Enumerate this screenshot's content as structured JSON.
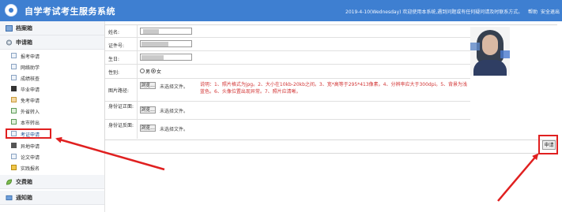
{
  "header": {
    "app_title": "自学考试考生服务系统",
    "welcome": "2019-4-10(Wednesday) 欢迎使用本系统,遇到问题或有任何疑问请及时联系方式。",
    "help": "帮助",
    "logout": "安全退出"
  },
  "sidebar": {
    "sections": [
      {
        "label": "档案箱",
        "icon": "archive-icon"
      },
      {
        "label": "申请箱",
        "icon": "gear-icon"
      },
      {
        "label": "交费箱",
        "icon": "leaf-icon"
      },
      {
        "label": "通知箱",
        "icon": "bell-icon"
      }
    ],
    "items": [
      {
        "label": "报考申请"
      },
      {
        "label": "网络助学"
      },
      {
        "label": "成绩核查"
      },
      {
        "label": "毕业申请"
      },
      {
        "label": "免考申请"
      },
      {
        "label": "外省转入"
      },
      {
        "label": "本市转出"
      },
      {
        "label": "考证申请"
      },
      {
        "label": "异地申请"
      },
      {
        "label": "论文申请"
      },
      {
        "label": "实践报名"
      }
    ],
    "active_item": "考证申请"
  },
  "form": {
    "name_label": "姓名:",
    "id_label": "证件号:",
    "birth_label": "生日:",
    "gender_label": "性别:",
    "gender_male": "男",
    "gender_female": "女",
    "gender_selected": "女",
    "photo_label": "图片路径:",
    "browse": "浏览...",
    "no_file": "未选择文件。",
    "note": "说明：1、照片格式为jpg。2、大小在10kb-20kb之间。3、宽*高等于295*413像素。4、分辨率应大于300dpi。5、背景为浅蓝色。6、头像位置出现异常。7、照片应清晰。",
    "id_front_label": "身份证正面:",
    "id_back_label": "身份证反面:",
    "submit": "申请"
  },
  "colors": {
    "header_bg": "#3e7fd1",
    "highlight": "#e02020",
    "note_text": "#d23636"
  }
}
